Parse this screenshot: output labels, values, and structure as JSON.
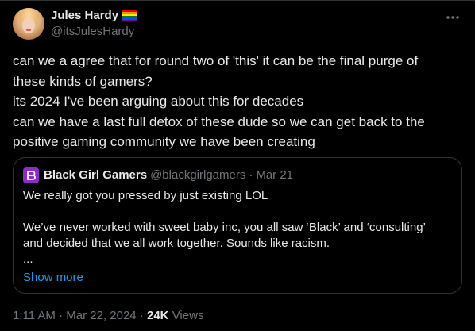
{
  "author": {
    "display_name": "Jules Hardy",
    "handle": "@itsJulesHardy",
    "flag_icon": "rainbow-flag-icon",
    "flag_colors": [
      "#e40303",
      "#ff8c00",
      "#ffed00",
      "#008026",
      "#004dff",
      "#750787"
    ],
    "avatar_icon": "profile-photo"
  },
  "more_icon": "more-horizontal-icon",
  "tweet": {
    "lines": [
      "can we a agree that for round two of 'this' it can be the final purge of",
      "these kinds of gamers?",
      "its 2024 I've been arguing about this for decades",
      "can we have a last full detox of these dude so we can get back to the",
      "positive gaming community we have been creating"
    ]
  },
  "quote": {
    "display_name": "Black Girl Gamers",
    "handle": "@blackgirlgamers",
    "separator": "·",
    "date": "Mar 21",
    "avatar_color": "#8b2cc9",
    "lines": [
      "We really got you pressed by just existing LOL",
      "",
      "We’ve never worked with sweet baby inc, you all saw ‘Black’ and ‘consulting’",
      "and decided that we all work together. Sounds like racism.",
      "..."
    ],
    "show_more": "Show more"
  },
  "meta": {
    "time": "1:11 AM",
    "separator": "·",
    "date": "Mar 22, 2024",
    "views_count": "24K",
    "views_label": "Views"
  },
  "colors": {
    "background": "#000000",
    "text": "#e7e9ea",
    "secondary": "#71767b",
    "link": "#1d9bf0",
    "border": "#2f3336"
  }
}
